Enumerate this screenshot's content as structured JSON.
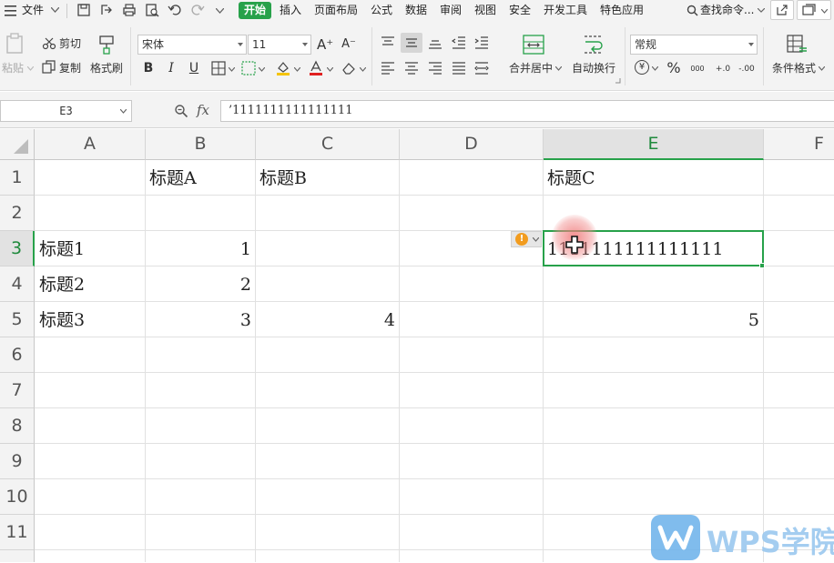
{
  "menubar": {
    "file_label": "文件",
    "tabs": [
      {
        "label": "开始",
        "active": true
      },
      {
        "label": "插入"
      },
      {
        "label": "页面布局"
      },
      {
        "label": "公式"
      },
      {
        "label": "数据"
      },
      {
        "label": "审阅"
      },
      {
        "label": "视图"
      },
      {
        "label": "安全"
      },
      {
        "label": "开发工具"
      },
      {
        "label": "特色应用"
      }
    ],
    "search_label": "查找命令..."
  },
  "ribbon": {
    "paste_label": "粘贴",
    "cut_label": "剪切",
    "copy_label": "复制",
    "format_painter_label": "格式刷",
    "font_name": "宋体",
    "font_size": "11",
    "bold_label": "B",
    "italic_label": "I",
    "underline_label": "U",
    "grow_font": "A⁺",
    "shrink_font": "A⁻",
    "merge_label": "合并居中",
    "wrap_label": "自动换行",
    "number_format": "常规",
    "currency_symbol": "¥",
    "percent_symbol": "%",
    "thousands_symbol": "000",
    "inc_decimal": "+.0",
    "dec_decimal": "-.00",
    "conditional_format_label": "条件格式"
  },
  "formula_bar": {
    "name_box": "E3",
    "fx_label": "fx",
    "value": "’1111111111111111"
  },
  "sheet": {
    "columns": [
      "A",
      "B",
      "C",
      "D",
      "E",
      "F"
    ],
    "rows": [
      "1",
      "2",
      "3",
      "4",
      "5",
      "6",
      "7",
      "8",
      "9",
      "10",
      "11"
    ],
    "active_cell": "E3",
    "cells": {
      "B1": "标题A",
      "C1": "标题B",
      "E1": "标题C",
      "A3": "标题1",
      "B3": "1",
      "E3": "1111111111111111",
      "A4": "标题2",
      "B4": "2",
      "A5": "标题3",
      "B5": "3",
      "C5": "4",
      "E5": "5"
    },
    "warning_icon": "!"
  },
  "watermark": {
    "text": "WPS学院"
  },
  "colors": {
    "accent_green": "#27a14a",
    "warning_orange": "#f29c1f",
    "watermark_blue": "#6ab0ea"
  }
}
